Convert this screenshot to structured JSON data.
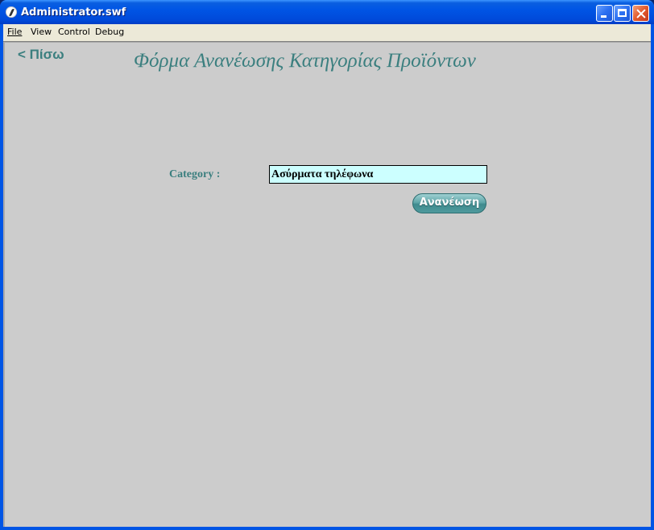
{
  "window": {
    "title": "Administrator.swf"
  },
  "menubar": {
    "file": "File",
    "view": "View",
    "control": "Control",
    "debug": "Debug"
  },
  "page": {
    "back_label": "< Πίσω",
    "title": "Φόρμα Ανανέωσης Κατηγορίας Προϊόντων",
    "category_label": "Category :",
    "category_value": "Ασύρματα τηλέφωνα",
    "update_button": "Ανανέωση"
  },
  "colors": {
    "accent_teal": "#3b7f7f",
    "input_background": "#ccffff",
    "stage_background": "#cccccc"
  }
}
